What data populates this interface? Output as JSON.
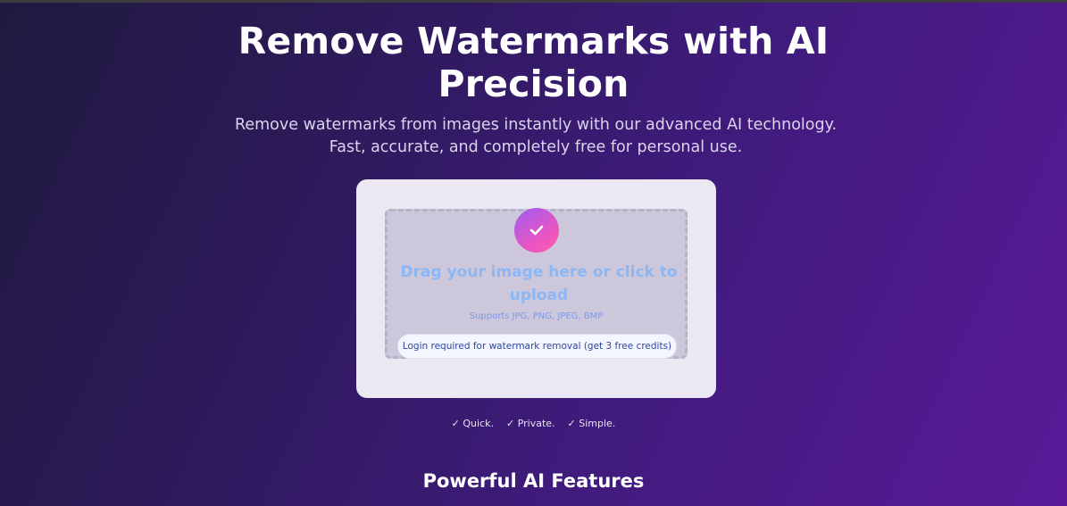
{
  "hero": {
    "title_line1": "Remove Watermarks with AI",
    "title_line2": "Precision",
    "subtitle": "Remove watermarks from images instantly with our advanced AI technology. Fast, accurate, and completely free for personal use."
  },
  "upload": {
    "icon": "check-icon",
    "title": "Drag your image here or click to upload",
    "formats": "Supports JPG, PNG, JPEG, BMP",
    "login_notice": "Login required for watermark removal (get 3 free credits)"
  },
  "highlights": [
    {
      "label": "✓ Quick."
    },
    {
      "label": "✓ Private."
    },
    {
      "label": "✓ Simple."
    }
  ],
  "features_section": {
    "title": "Powerful AI Features"
  },
  "colors": {
    "background_start": "#201a3f",
    "background_end": "#5a1a98",
    "card_background": "#ece8f3",
    "accent_pink": "#ff5cae",
    "accent_purple": "#9d5cf0",
    "link_blue": "#8cb6f4"
  }
}
